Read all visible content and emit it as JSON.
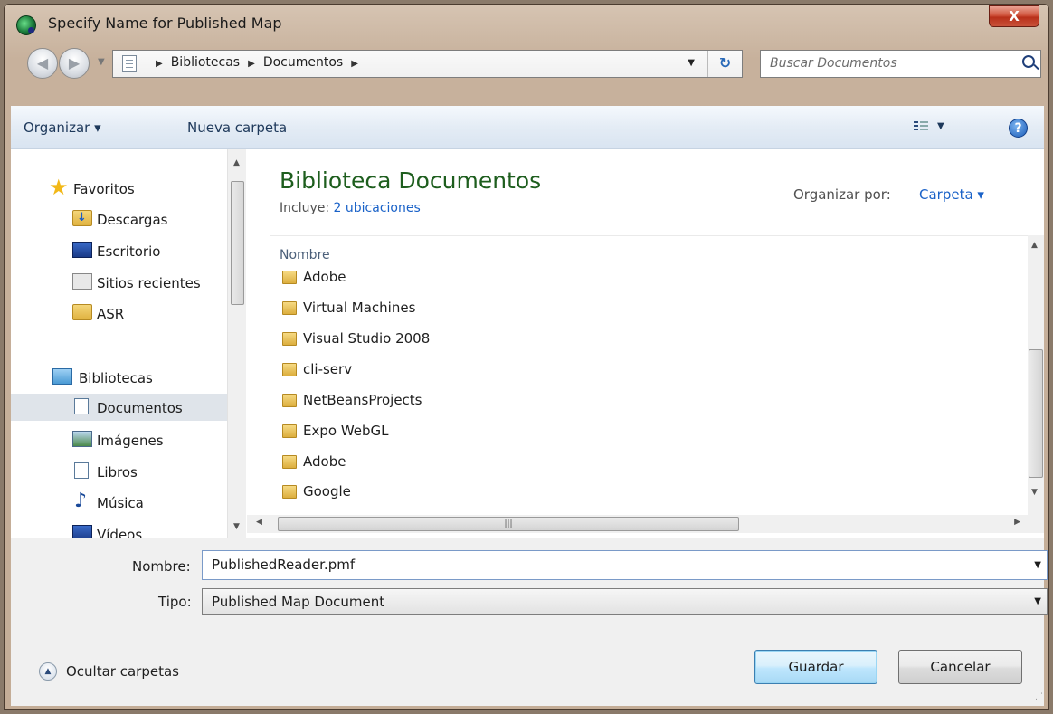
{
  "window": {
    "title": "Specify Name for Published Map",
    "close_label": "X"
  },
  "address": {
    "crumbs": [
      "Bibliotecas",
      "Documentos"
    ],
    "search_placeholder": "Buscar Documentos"
  },
  "toolbar": {
    "organize": "Organizar ▾",
    "new_folder": "Nueva carpeta",
    "help": "?"
  },
  "navigation": {
    "favorites": "Favoritos",
    "downloads": "Descargas",
    "desktop": "Escritorio",
    "recent": "Sitios recientes",
    "asr": "ASR",
    "libraries": "Bibliotecas",
    "documents": "Documentos",
    "images": "Imágenes",
    "books": "Libros",
    "music": "Música",
    "videos": "Vídeos"
  },
  "content": {
    "library_title": "Biblioteca Documentos",
    "includes_label": "Incluye:",
    "includes_link": "2 ubicaciones",
    "organize_by_label": "Organizar por:",
    "organize_by_value": "Carpeta ▾",
    "column_name": "Nombre",
    "files": [
      "Adobe",
      "Virtual Machines",
      "Visual Studio 2008",
      "cli-serv",
      "NetBeansProjects",
      "Expo WebGL",
      "Adobe",
      "Google"
    ]
  },
  "form": {
    "name_label": "Nombre:",
    "name_value": "PublishedReader.pmf",
    "type_label": "Tipo:",
    "type_value": "Published Map Document",
    "hide_folders": "Ocultar carpetas",
    "save": "Guardar",
    "cancel": "Cancelar"
  },
  "icons": {
    "app": "globe-icon",
    "folder": "folder-icon",
    "search": "search-icon",
    "help": "help-icon",
    "refresh": "refresh-icon"
  },
  "colors": {
    "title_green": "#1e5e1e",
    "link_blue": "#1a62c8",
    "close_red": "#c8523a"
  }
}
